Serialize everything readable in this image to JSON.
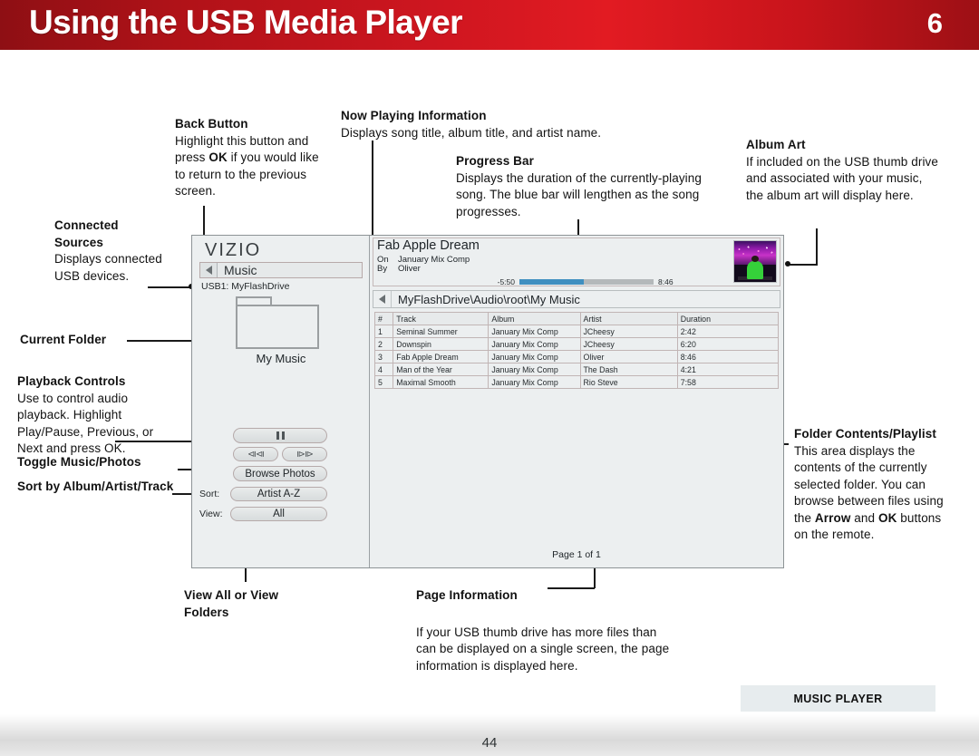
{
  "header": {
    "title": "Using the USB Media Player",
    "chapter": "6",
    "accent_color": "#cf1620"
  },
  "callouts": {
    "back_button": {
      "heading": "Back Button",
      "body": "Highlight this button and press OK if you would like to return to the previous screen.",
      "body_parts": [
        "Highlight this button and press ",
        "OK",
        " if you would like to return to the previous screen."
      ]
    },
    "now_playing": {
      "heading": "Now Playing Information",
      "body": "Displays song title, album title, and artist name."
    },
    "progress_bar": {
      "heading": "Progress Bar",
      "body": "Displays the duration of the currently-playing song. The blue bar will lengthen as the song progresses."
    },
    "album_art": {
      "heading": "Album Art",
      "body": "If included on the USB thumb drive and associated with your music, the album art will display here."
    },
    "connected_sources": {
      "heading": "Connected Sources",
      "body": "Displays connected USB devices."
    },
    "current_folder": {
      "heading": "Current Folder"
    },
    "playback_controls": {
      "heading": "Playback Controls",
      "body": "Use to control audio playback. Highlight Play/Pause, Previous, or Next and press OK."
    },
    "toggle_music_photos": {
      "heading": "Toggle Music/Photos"
    },
    "sort_by": {
      "heading": "Sort by Album/Artist/Track"
    },
    "view_all_or_folders": {
      "heading": "View All or View Folders"
    },
    "page_information": {
      "heading": "Page Information",
      "body": "If your USB thumb drive has more files than can be displayed on a single screen, the page information is displayed here."
    },
    "folder_contents": {
      "heading": "Folder Contents/Playlist",
      "body_1": "This area displays the contents of the currently selected folder. You can browse between files using the ",
      "body_bold_1": "Arrow",
      "body_2": " and ",
      "body_bold_2": "OK",
      "body_3": " buttons on the remote."
    }
  },
  "tv": {
    "brand": "VIZIO",
    "back_label": "Music",
    "back_icon": "triangle-left-icon",
    "source_label": "USB1: MyFlashDrive",
    "folder_name": "My Music",
    "folder_icon": "folder-icon",
    "controls": {
      "play_pause": "pause-icon",
      "previous": "⧏⧏",
      "next": "⧐⧐",
      "browse_label": "Browse Photos",
      "sort_label": "Sort:",
      "sort_value": "Artist A-Z",
      "view_label": "View:",
      "view_value": "All"
    },
    "now_playing": {
      "title": "Fab Apple Dream",
      "on_label": "On",
      "album": "January Mix Comp",
      "by_label": "By",
      "artist": "Oliver",
      "elapsed": "-5:50",
      "total": "8:46",
      "progress_percent": 48,
      "bar_color": "#3f8fc0"
    },
    "path": "MyFlashDrive\\Audio\\root\\My Music",
    "path_back_icon": "triangle-left-icon",
    "table": {
      "columns": [
        "#",
        "Track",
        "Album",
        "Artist",
        "Duration"
      ],
      "rows": [
        [
          "1",
          "Seminal Summer",
          "January Mix Comp",
          "JCheesy",
          "2:42"
        ],
        [
          "2",
          "Downspin",
          "January Mix Comp",
          "JCheesy",
          "6:20"
        ],
        [
          "3",
          "Fab Apple Dream",
          "January Mix Comp",
          "Oliver",
          "8:46"
        ],
        [
          "4",
          "Man of the Year",
          "January Mix Comp",
          "The Dash",
          "4:21"
        ],
        [
          "5",
          "Maximal Smooth",
          "January Mix Comp",
          "Rio Steve",
          "7:58"
        ]
      ]
    },
    "page_info": "Page 1 of 1"
  },
  "footer": {
    "tag": "MUSIC PLAYER",
    "page_number": "44"
  }
}
